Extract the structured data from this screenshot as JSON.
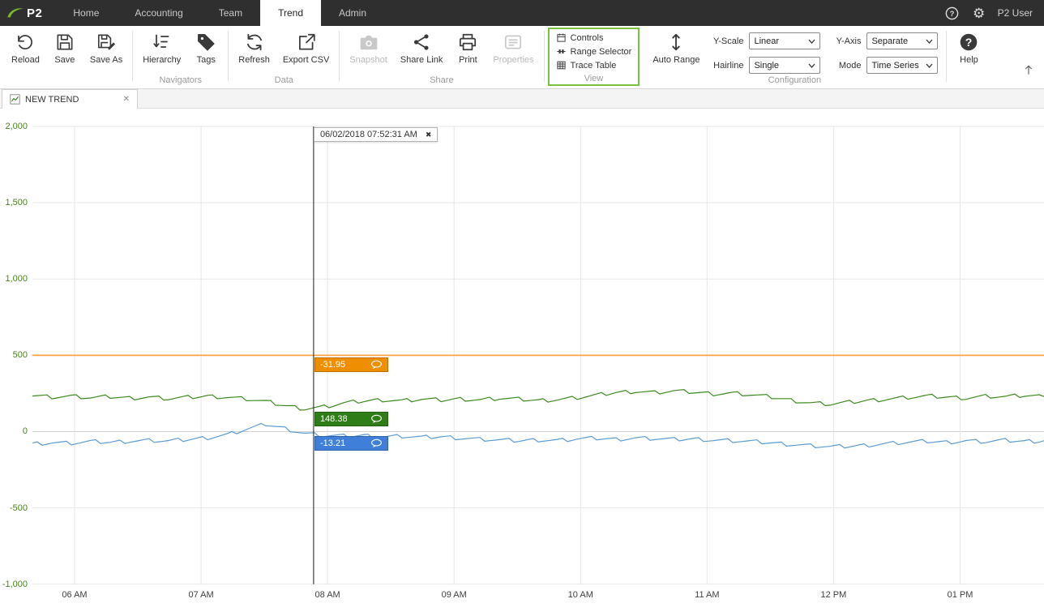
{
  "topbar": {
    "logo_text": "P2",
    "nav": [
      {
        "label": "Home",
        "active": false
      },
      {
        "label": "Accounting",
        "active": false
      },
      {
        "label": "Team",
        "active": false
      },
      {
        "label": "Trend",
        "active": true
      },
      {
        "label": "Admin",
        "active": false
      }
    ],
    "user_name": "P2 User"
  },
  "ribbon": {
    "file_group": {
      "caption": "",
      "buttons": [
        {
          "label": "Reload"
        },
        {
          "label": "Save"
        },
        {
          "label": "Save As"
        }
      ]
    },
    "navigators_group": {
      "caption": "Navigators",
      "buttons": [
        {
          "label": "Hierarchy"
        },
        {
          "label": "Tags"
        }
      ]
    },
    "data_group": {
      "caption": "Data",
      "buttons": [
        {
          "label": "Refresh"
        },
        {
          "label": "Export CSV"
        }
      ]
    },
    "share_group": {
      "caption": "Share",
      "buttons": [
        {
          "label": "Snapshot",
          "disabled": true
        },
        {
          "label": "Share Link",
          "disabled": false
        },
        {
          "label": "Print",
          "disabled": false
        },
        {
          "label": "Properties",
          "disabled": true
        }
      ]
    },
    "view_group": {
      "caption": "View",
      "highlight_color": "#7cc142",
      "items": [
        {
          "label": "Controls"
        },
        {
          "label": "Range Selector"
        },
        {
          "label": "Trace Table"
        }
      ]
    },
    "configuration_group": {
      "caption": "Configuration",
      "auto_range_label": "Auto Range",
      "fields": [
        {
          "label": "Y-Scale",
          "value": "Linear"
        },
        {
          "label": "Hairline",
          "value": "Single"
        },
        {
          "label": "Y-Axis",
          "value": "Separate"
        },
        {
          "label": "Mode",
          "value": "Time Series"
        }
      ]
    },
    "help_label": "Help"
  },
  "document_tabs": [
    {
      "label": "NEW TREND"
    }
  ],
  "chart_data": {
    "type": "line",
    "title": "",
    "grid": true,
    "y_axis": {
      "range": [
        -1000,
        2000
      ],
      "ticks": [
        2000,
        1500,
        1000,
        500,
        0,
        -500,
        -1000
      ],
      "tick_labels": [
        "2,000",
        "1,500",
        "1,000",
        "500",
        "0",
        "-500",
        "-1,000"
      ],
      "label_color": "#4b7f1f"
    },
    "x_axis": {
      "labels": [
        "06 AM",
        "07 AM",
        "08 AM",
        "09 AM",
        "10 AM",
        "11 AM",
        "12 PM",
        "01 PM"
      ]
    },
    "hairline": {
      "timestamp": "06/02/2018 07:52:31 AM",
      "x_fraction": 0.278,
      "labels": [
        {
          "text": "-31.95",
          "display_at": 500,
          "color": "#ef8e00"
        },
        {
          "text": "148.38",
          "display_at": 148.38,
          "color": "#2e7d17"
        },
        {
          "text": "-13.21",
          "display_at": -13.21,
          "color": "#3f7fd9"
        }
      ]
    },
    "series": [
      {
        "name": "orange-trace",
        "color": "#ffa245",
        "stroke_width": 1.8,
        "values": [
          500,
          500
        ]
      },
      {
        "name": "green-trace",
        "color": "#3c8a1e",
        "stroke_width": 1.2,
        "values": [
          238,
          228,
          232,
          222,
          228,
          220,
          226,
          216,
          224,
          232,
          226,
          214,
          196,
          170,
          150,
          162,
          186,
          200,
          208,
          202,
          212,
          206,
          214,
          208,
          218,
          212,
          204,
          210,
          222,
          238,
          256,
          264,
          256,
          266,
          258,
          248,
          252,
          240,
          226,
          206,
          188,
          180,
          192,
          204,
          214,
          224,
          232,
          226,
          220,
          232,
          228,
          236,
          230
        ]
      },
      {
        "name": "blue-trace",
        "color": "#5b9bd5",
        "stroke_width": 1.2,
        "values": [
          -80,
          -72,
          -76,
          -66,
          -70,
          -62,
          -58,
          -62,
          -52,
          -40,
          -20,
          15,
          48,
          20,
          -12,
          -26,
          -30,
          -26,
          -34,
          -30,
          -38,
          -34,
          -42,
          -50,
          -56,
          -60,
          -54,
          -58,
          -48,
          -44,
          -50,
          -42,
          -46,
          -52,
          -48,
          -56,
          -60,
          -66,
          -74,
          -84,
          -92,
          -100,
          -96,
          -88,
          -78,
          -70,
          -64,
          -70,
          -60,
          -66,
          -58,
          -64,
          -60
        ]
      }
    ]
  }
}
